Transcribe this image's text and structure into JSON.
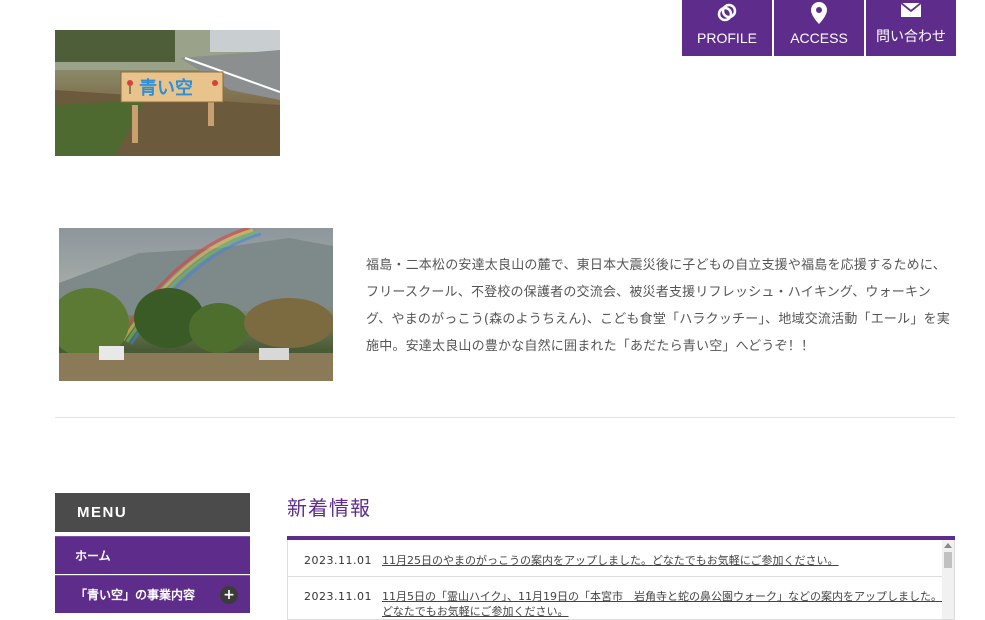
{
  "nav": {
    "profile_label": "PROFILE",
    "access_label": "ACCESS",
    "contact_label": "問い合わせ",
    "accent": "#5e2d8c"
  },
  "sign_photo": {
    "sign_text": "青い空"
  },
  "intro": {
    "text": "福島・二本松の安達太良山の麓で、東日本大震災後に子どもの自立支援や福島を応援するために、フリースクール、不登校の保護者の交流会、被災者支援リフレッシュ・ハイキング、ウォーキング、やまのがっこう(森のようちえん)、こども食堂「ハラクッチー」、地域交流活動「エール」を実施中。安達太良山の豊かな自然に囲まれた「あだたら青い空」へどうぞ！！"
  },
  "sidebar": {
    "heading": "MENU",
    "items": [
      {
        "label": "ホーム"
      },
      {
        "label": "「青い空」の事業内容",
        "toggle": "+"
      }
    ]
  },
  "news": {
    "title": "新着情報",
    "rows": [
      {
        "date": "2023.11.01",
        "text": "11月25日のやまのがっこうの案内をアップしました。どなたでもお気軽にご参加ください。"
      },
      {
        "date": "2023.11.01",
        "text": "11月5日の「霊山ハイク」、11月19日の「本宮市　岩角寺と蛇の鼻公園ウォーク」などの案内をアップしました。どなたでもお気軽にご参加ください。"
      }
    ]
  }
}
